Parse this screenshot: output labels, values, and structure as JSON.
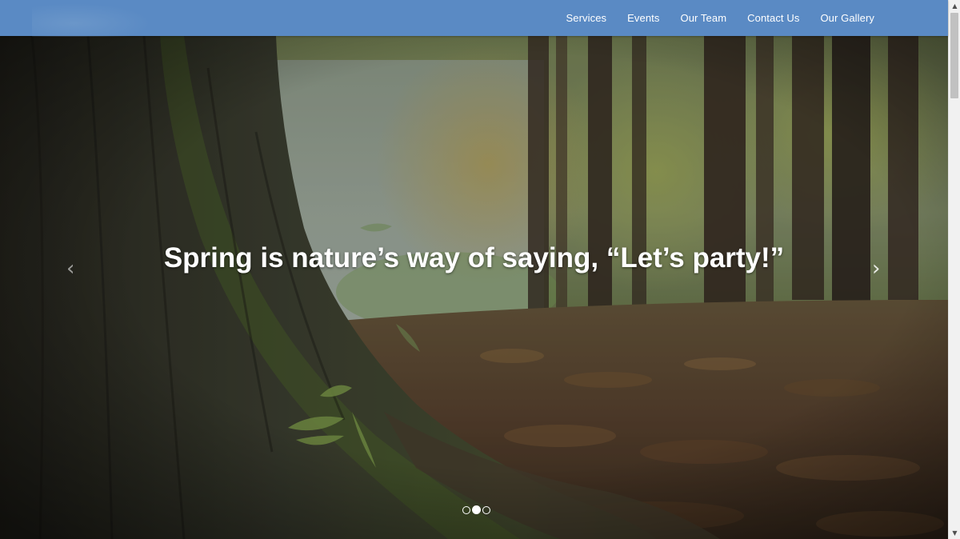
{
  "nav": {
    "items": [
      {
        "label": "Services"
      },
      {
        "label": "Events"
      },
      {
        "label": "Our Team"
      },
      {
        "label": "Contact Us"
      },
      {
        "label": "Our Gallery"
      }
    ]
  },
  "hero": {
    "caption": "Spring is nature’s way of saying, “Let’s party!”",
    "prev_arrow": "‹",
    "next_arrow": "›",
    "slide_count": 3,
    "active_slide": 2
  },
  "scrollbar": {
    "up_arrow": "▲",
    "down_arrow": "▼"
  },
  "colors": {
    "navbar": "#5a8ac4",
    "nav_text": "#ffffff",
    "caption_text": "#ffffff"
  }
}
